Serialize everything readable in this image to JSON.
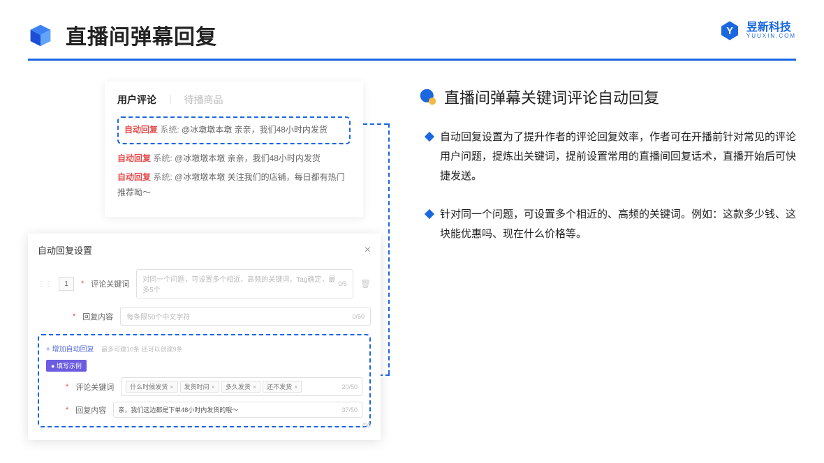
{
  "header": {
    "title": "直播间弹幕回复",
    "brand_cn": "昱新科技",
    "brand_en": "YUUXIN.COM"
  },
  "comments": {
    "tab_active": "用户评论",
    "tab_inactive": "待播商品",
    "highlighted": {
      "tag": "自动回复",
      "prefix": "系统:",
      "text": "@冰墩墩本墩 亲亲，我们48小时内发货"
    },
    "line2": {
      "tag": "自动回复",
      "prefix": "系统:",
      "text": "@冰墩墩本墩 亲亲，我们48小时内发货"
    },
    "line3": {
      "tag": "自动回复",
      "prefix": "系统:",
      "text": "@冰墩墩本墩 关注我们的店铺，每日都有热门推荐呦～"
    }
  },
  "settings": {
    "title": "自动回复设置",
    "index": "1",
    "kw_label": "评论关键词",
    "kw_placeholder": "对同一个问题，可设置多个相近、高频的关键词，Tag确定，最多5个",
    "kw_count": "0/5",
    "content_label": "回复内容",
    "content_placeholder": "每条限50个中文字符",
    "content_count": "0/50",
    "add_link": "+ 增加自动回复",
    "add_hint": "最多可建10条 还可以创建9条",
    "example_badge": "● 填写示例",
    "ex_kw_label": "评论关键词",
    "ex_tags": [
      "什么时候发货",
      "发货时间",
      "多久发货",
      "还不发货"
    ],
    "ex_kw_count": "20/50",
    "ex_content_label": "回复内容",
    "ex_content_value": "亲，我们这边都是下单48小时内发货的哦～",
    "ex_content_count": "37/50",
    "bottom_count": "/50"
  },
  "right": {
    "section_title": "直播间弹幕关键词评论自动回复",
    "bullet1": "自动回复设置为了提升作者的评论回复效率，作者可在开播前针对常见的评论用户问题，提炼出关键词，提前设置常用的直播间回复话术，直播开始后可快捷发送。",
    "bullet2": "针对同一个问题，可设置多个相近的、高频的关键词。例如：这款多少钱、这块能优惠吗、现在什么价格等。"
  }
}
